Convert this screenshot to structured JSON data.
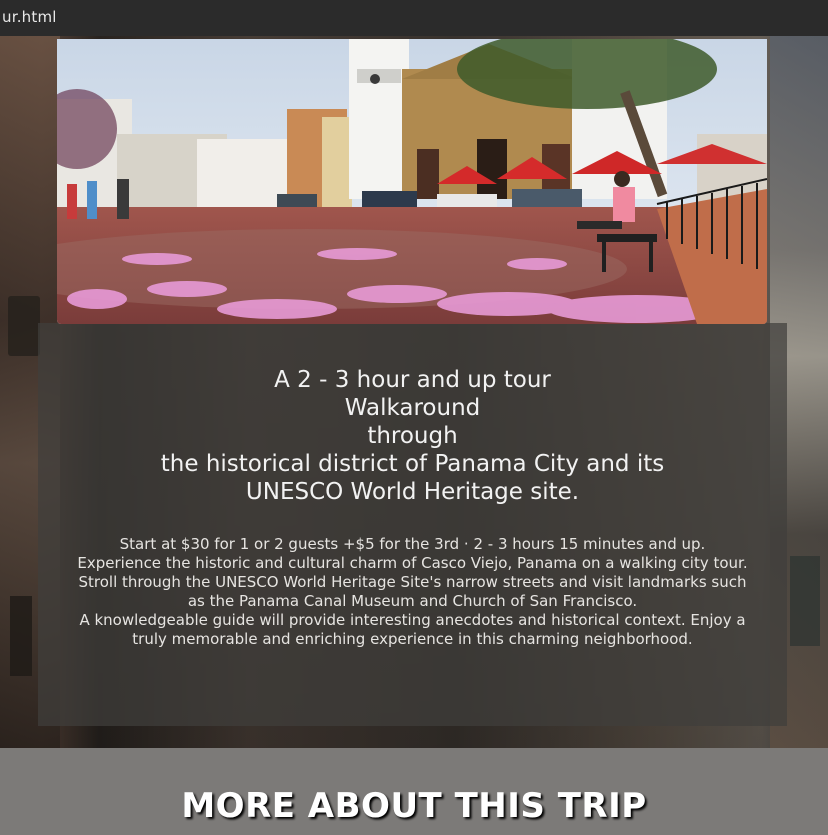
{
  "browser": {
    "tab_title": "ur.html"
  },
  "hero_image": {
    "alt": "Plaza in Casco Viejo, Panama with cathedral and pink blossoms"
  },
  "headline": {
    "lines": [
      "A 2 - 3 hour and up tour",
      "Walkaround",
      "through",
      "the historical district of Panama City and its",
      "UNESCO World Heritage site."
    ]
  },
  "description": {
    "line1": "Start at $30 for 1 or 2 guests +$5 for the 3rd · 2 - 3 hours 15 minutes and up.",
    "line2": "Experience the historic and cultural charm of Casco Viejo, Panama on a walking city tour. Stroll through the UNESCO World Heritage Site's narrow streets and visit landmarks such as the Panama Canal Museum and Church of San Francisco.",
    "line3": "A knowledgeable guide will provide interesting anecdotes and historical context. Enjoy a truly memorable and enriching experience in this charming neighborhood."
  },
  "section": {
    "title": "MORE ABOUT THIS TRIP"
  },
  "colors": {
    "card_overlay": "#403e3c",
    "band": "#7c7a78",
    "text": "#f2f2f2"
  }
}
